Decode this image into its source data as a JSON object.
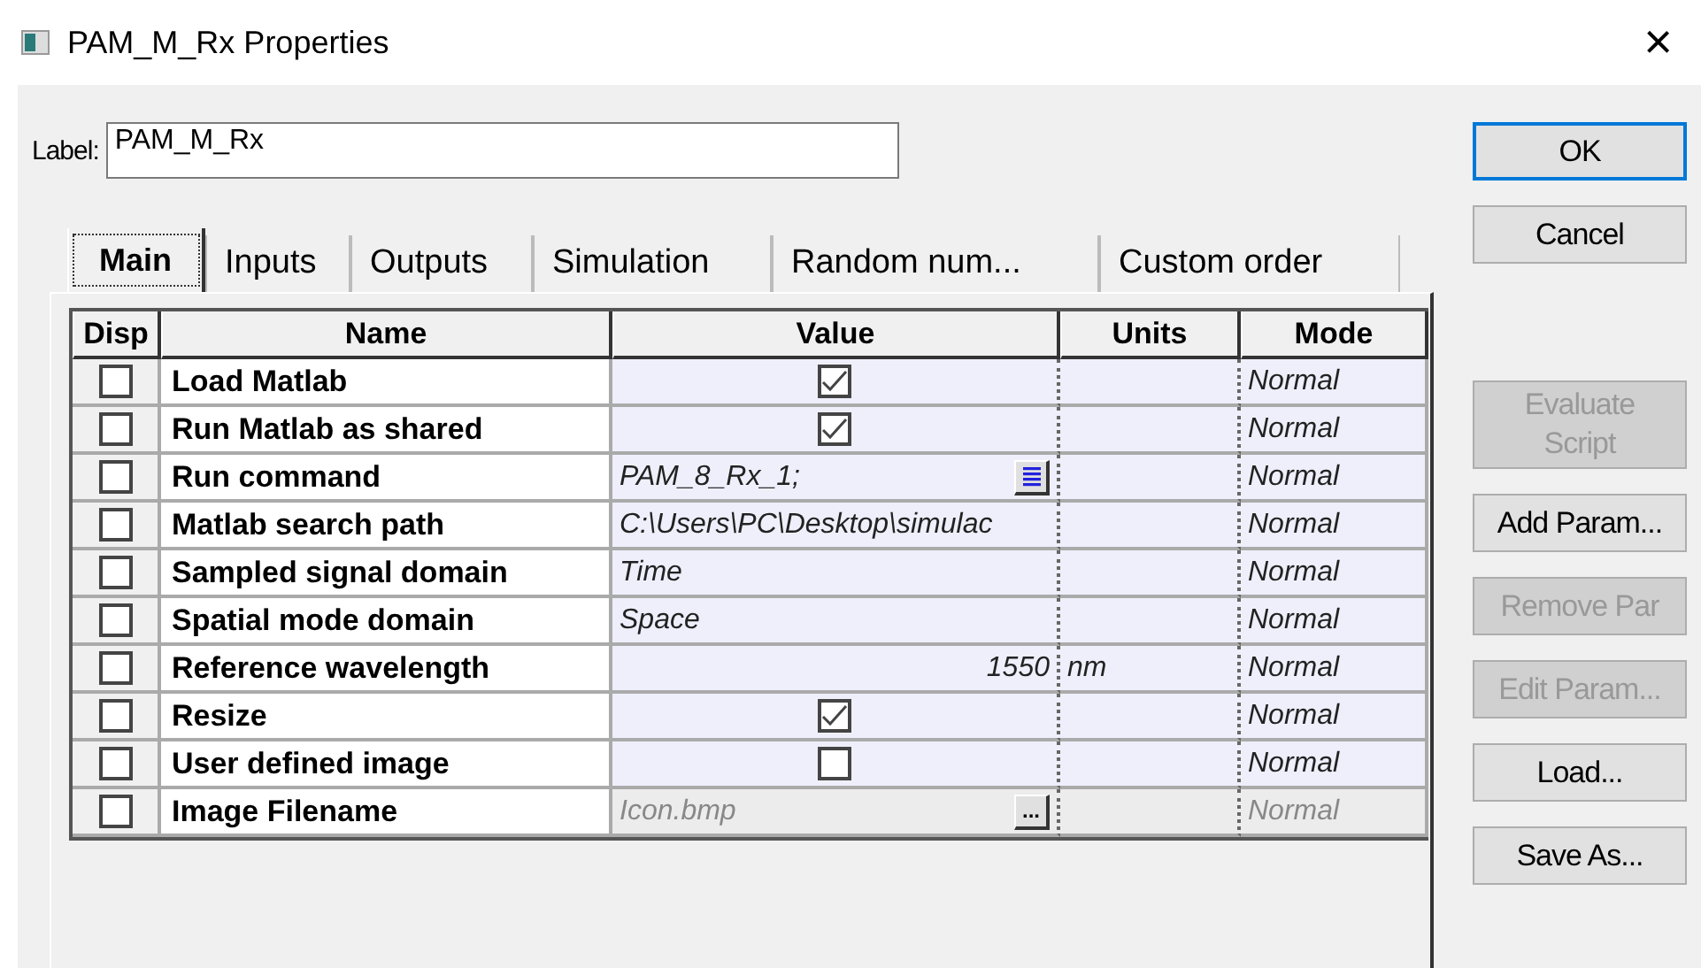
{
  "window": {
    "title": "PAM_M_Rx Properties",
    "close": "×"
  },
  "label_field": {
    "label": "Label:",
    "value": "PAM_M_Rx"
  },
  "tabs": [
    {
      "label": "Main",
      "selected": true
    },
    {
      "label": "Inputs",
      "selected": false
    },
    {
      "label": "Outputs",
      "selected": false
    },
    {
      "label": "Simulation",
      "selected": false
    },
    {
      "label": "Random num...",
      "selected": false
    },
    {
      "label": "Custom order",
      "selected": false
    }
  ],
  "table": {
    "columns": [
      "Disp",
      "Name",
      "Value",
      "Units",
      "Mode"
    ],
    "rows": [
      {
        "disp": false,
        "name": "Load Matlab",
        "value": {
          "kind": "checkbox",
          "checked": true
        },
        "units": "",
        "mode": "Normal",
        "disabled": false
      },
      {
        "disp": false,
        "name": "Run Matlab as shared",
        "value": {
          "kind": "checkbox",
          "checked": true
        },
        "units": "",
        "mode": "Normal",
        "disabled": false
      },
      {
        "disp": false,
        "name": "Run command",
        "value": {
          "kind": "list",
          "text": "PAM_8_Rx_1;"
        },
        "units": "",
        "mode": "Normal",
        "disabled": false
      },
      {
        "disp": false,
        "name": "Matlab search path",
        "value": {
          "kind": "text",
          "text": "C:\\Users\\PC\\Desktop\\simulac"
        },
        "units": "",
        "mode": "Normal",
        "disabled": false
      },
      {
        "disp": false,
        "name": "Sampled signal domain",
        "value": {
          "kind": "text",
          "text": "Time"
        },
        "units": "",
        "mode": "Normal",
        "disabled": false
      },
      {
        "disp": false,
        "name": "Spatial mode domain",
        "value": {
          "kind": "text",
          "text": "Space"
        },
        "units": "",
        "mode": "Normal",
        "disabled": false
      },
      {
        "disp": false,
        "name": "Reference wavelength",
        "value": {
          "kind": "number",
          "text": "1550"
        },
        "units": "nm",
        "mode": "Normal",
        "disabled": false
      },
      {
        "disp": false,
        "name": "Resize",
        "value": {
          "kind": "checkbox",
          "checked": true
        },
        "units": "",
        "mode": "Normal",
        "disabled": false
      },
      {
        "disp": false,
        "name": "User defined image",
        "value": {
          "kind": "checkbox",
          "checked": false
        },
        "units": "",
        "mode": "Normal",
        "disabled": false
      },
      {
        "disp": false,
        "name": "Image Filename",
        "value": {
          "kind": "browse",
          "text": "Icon.bmp",
          "button": "..."
        },
        "units": "",
        "mode": "Normal",
        "disabled": true
      }
    ]
  },
  "dialog_buttons": [
    {
      "label": "OK",
      "default": true,
      "disabled": false
    },
    {
      "label": "Cancel",
      "default": false,
      "disabled": false
    }
  ],
  "tool_buttons": [
    {
      "label": "Evaluate Script",
      "disabled": true
    },
    {
      "label": "Add Param...",
      "disabled": false
    },
    {
      "label": "Remove Par",
      "disabled": true
    },
    {
      "label": "Edit Param...",
      "disabled": true
    },
    {
      "label": "Load...",
      "disabled": false
    },
    {
      "label": "Save As...",
      "disabled": false
    }
  ]
}
